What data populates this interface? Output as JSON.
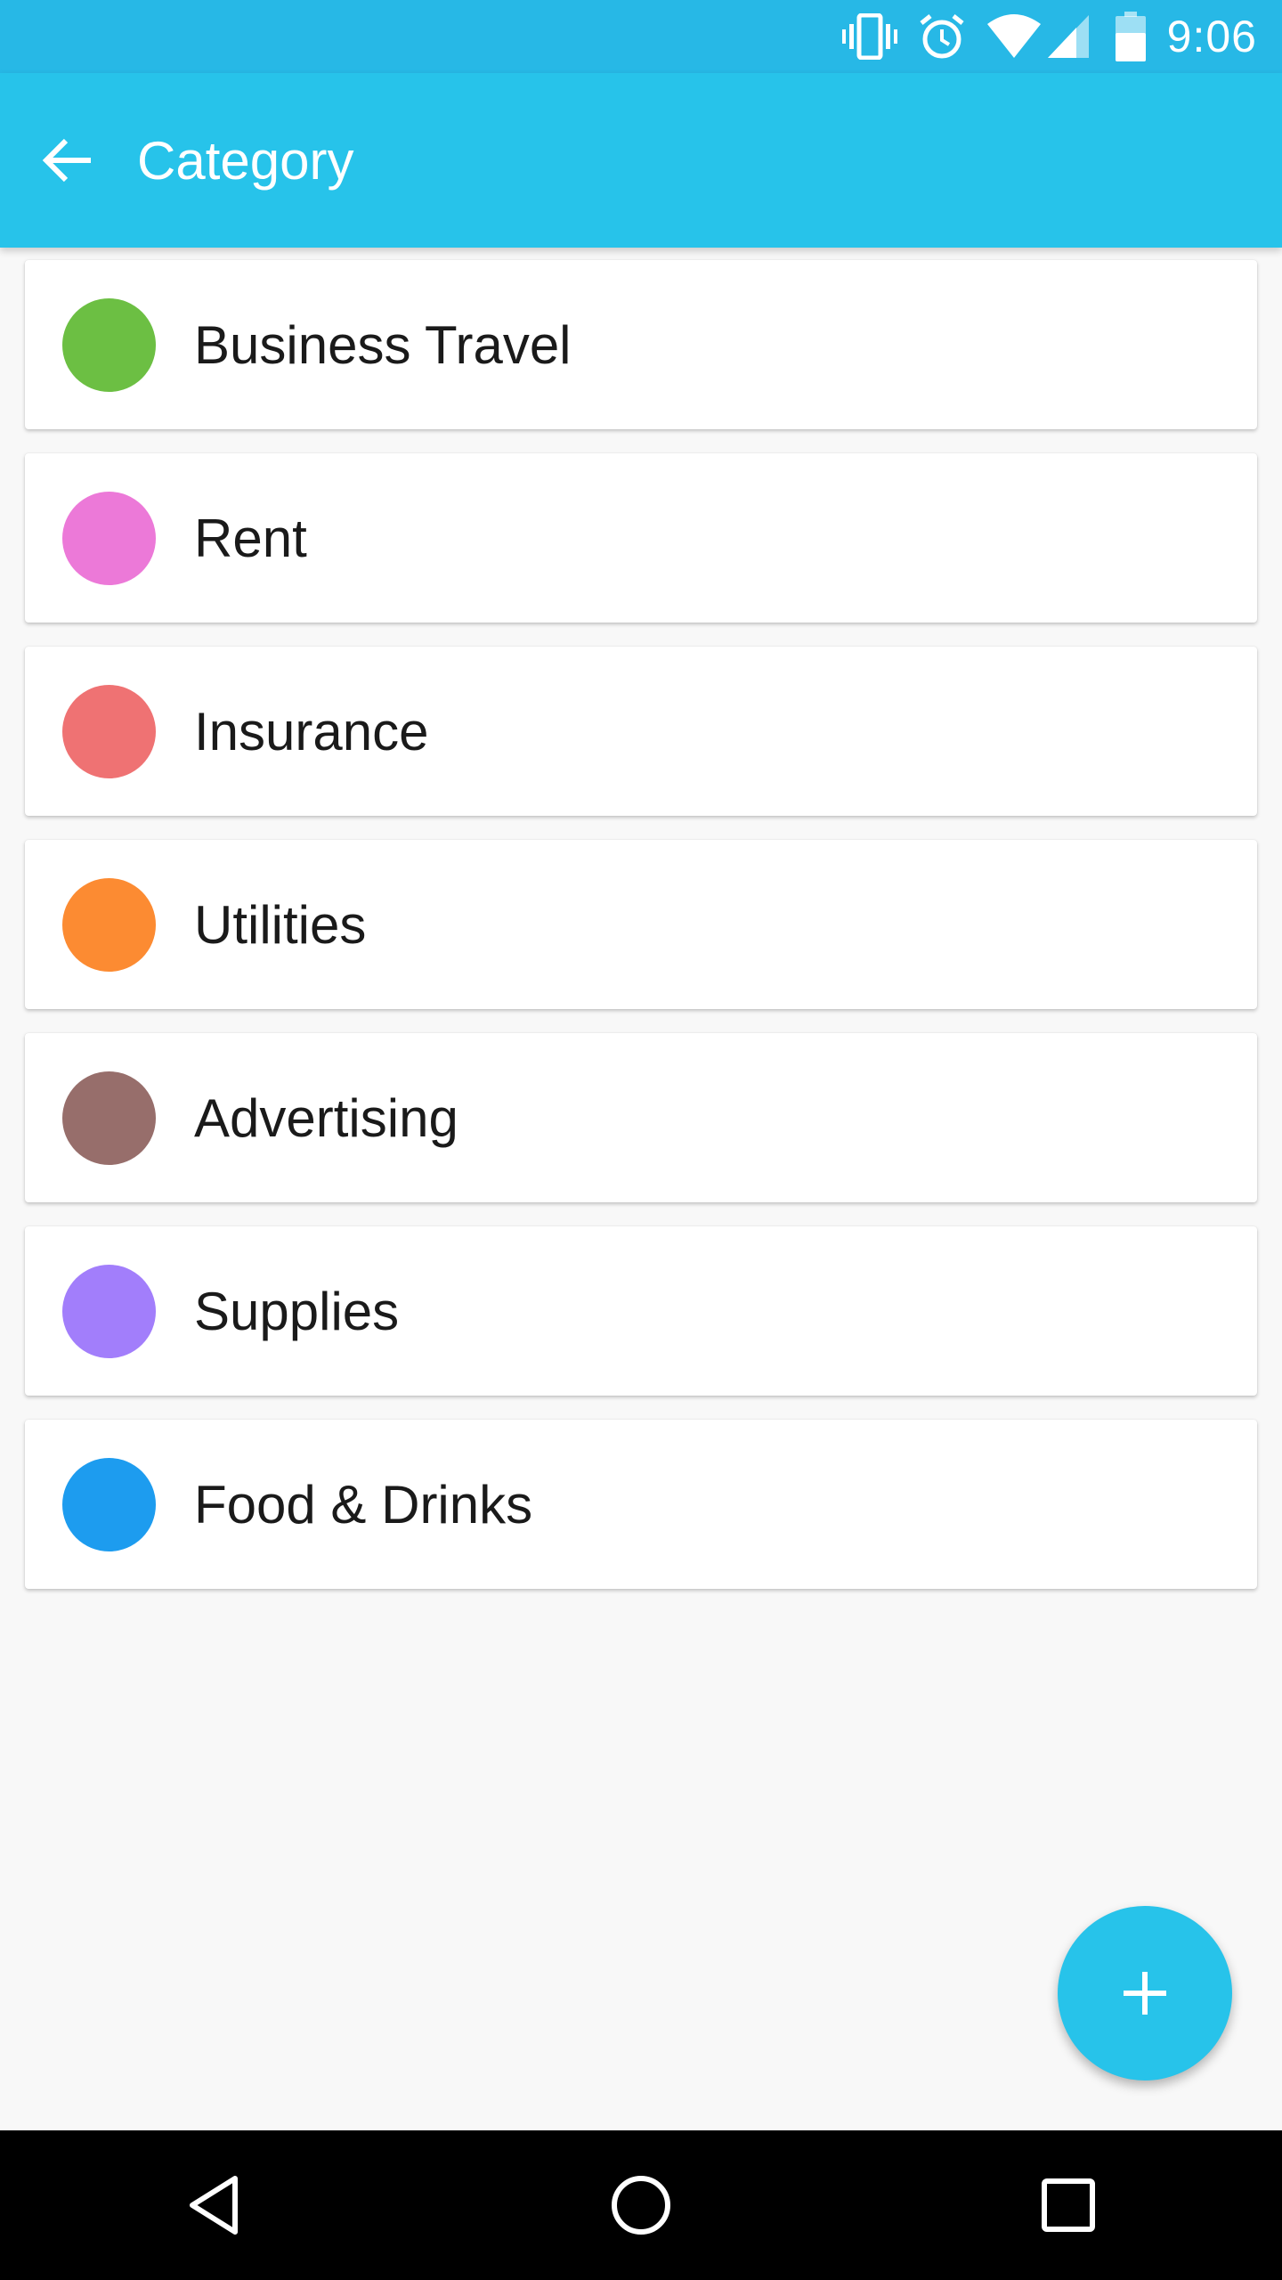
{
  "status_bar": {
    "time": "9:06",
    "icons": [
      "vibrate-icon",
      "alarm-icon",
      "wifi-icon",
      "signal-icon",
      "battery-icon"
    ]
  },
  "app_bar": {
    "title": "Category",
    "back_icon": "arrow-back-icon"
  },
  "categories": [
    {
      "label": "Business Travel",
      "color": "#6cbf43"
    },
    {
      "label": "Rent",
      "color": "#ec79d8"
    },
    {
      "label": "Insurance",
      "color": "#ef7273"
    },
    {
      "label": "Utilities",
      "color": "#fc8b32"
    },
    {
      "label": "Advertising",
      "color": "#976e6b"
    },
    {
      "label": "Supplies",
      "color": "#a27efb"
    },
    {
      "label": "Food & Drinks",
      "color": "#1d9cef"
    }
  ],
  "fab": {
    "icon": "plus-icon"
  },
  "nav_bar": {
    "icons": [
      "back-triangle-icon",
      "home-circle-icon",
      "recents-square-icon"
    ]
  },
  "colors": {
    "status_bar": "#27b8e6",
    "app_bar": "#27c3ea",
    "accent": "#27c3ea",
    "background": "#f8f8f8"
  }
}
